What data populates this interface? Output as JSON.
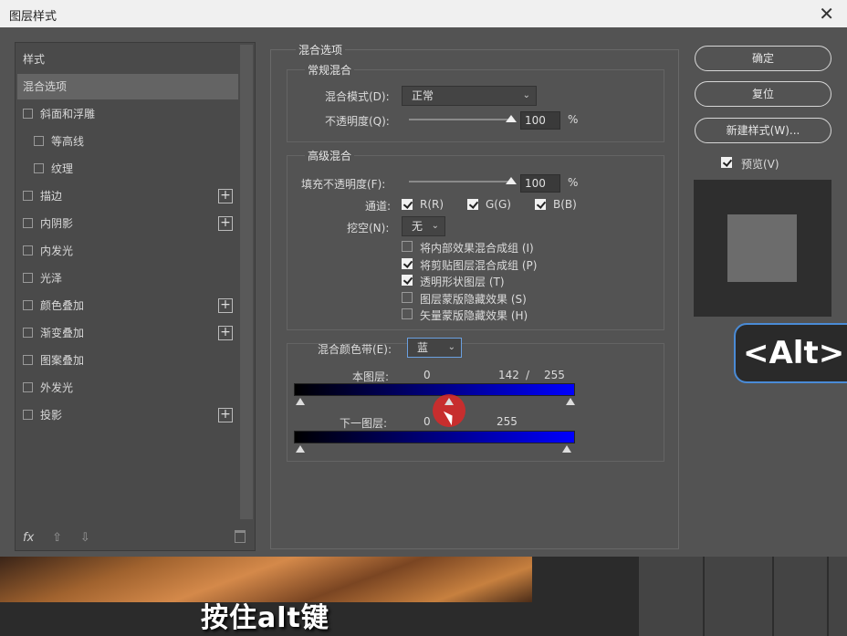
{
  "window": {
    "title": "图层样式",
    "close_icon": "close-icon"
  },
  "left_panel": {
    "header": "样式",
    "items": [
      {
        "label": "混合选项",
        "checkbox": false,
        "plus": false,
        "selected": true,
        "indent": 0
      },
      {
        "label": "斜面和浮雕",
        "checkbox": true,
        "plus": false,
        "indent": 0
      },
      {
        "label": "等高线",
        "checkbox": true,
        "plus": false,
        "indent": 1
      },
      {
        "label": "纹理",
        "checkbox": true,
        "plus": false,
        "indent": 1
      },
      {
        "label": "描边",
        "checkbox": true,
        "plus": true,
        "indent": 0
      },
      {
        "label": "内阴影",
        "checkbox": true,
        "plus": true,
        "indent": 0
      },
      {
        "label": "内发光",
        "checkbox": true,
        "plus": false,
        "indent": 0
      },
      {
        "label": "光泽",
        "checkbox": true,
        "plus": false,
        "indent": 0
      },
      {
        "label": "颜色叠加",
        "checkbox": true,
        "plus": true,
        "indent": 0
      },
      {
        "label": "渐变叠加",
        "checkbox": true,
        "plus": true,
        "indent": 0
      },
      {
        "label": "图案叠加",
        "checkbox": true,
        "plus": false,
        "indent": 0
      },
      {
        "label": "外发光",
        "checkbox": true,
        "plus": false,
        "indent": 0
      },
      {
        "label": "投影",
        "checkbox": true,
        "plus": true,
        "indent": 0
      }
    ],
    "footer": {
      "fx": "fx",
      "up": "⇧",
      "down": "⇩"
    }
  },
  "blend_options": {
    "title": "混合选项",
    "general": {
      "title": "常规混合",
      "mode_label": "混合模式(D):",
      "mode_value": "正常",
      "opacity_label": "不透明度(Q):",
      "opacity_value": "100",
      "percent": "%"
    },
    "advanced": {
      "title": "高级混合",
      "fill_label": "填充不透明度(F):",
      "fill_value": "100",
      "percent": "%",
      "channels_label": "通道:",
      "channel_r": "R(R)",
      "channel_g": "G(G)",
      "channel_b": "B(B)",
      "knockout_label": "挖空(N):",
      "knockout_value": "无",
      "options": [
        {
          "label": "将内部效果混合成组 (I)",
          "checked": false
        },
        {
          "label": "将剪贴图层混合成组 (P)",
          "checked": true
        },
        {
          "label": "透明形状图层 (T)",
          "checked": true
        },
        {
          "label": "图层蒙版隐藏效果 (S)",
          "checked": false
        },
        {
          "label": "矢量蒙版隐藏效果 (H)",
          "checked": false
        }
      ]
    },
    "blend_if": {
      "label": "混合颜色带(E):",
      "value": "蓝",
      "this_layer_label": "本图层:",
      "this_layer_left": "0",
      "this_layer_mid": "142",
      "this_layer_sep": "/",
      "this_layer_right": "255",
      "under_layer_label": "下一图层:",
      "under_layer_left": "0",
      "under_layer_right": "255"
    }
  },
  "buttons": {
    "ok": "确定",
    "reset": "复位",
    "new_style": "新建样式(W)...",
    "preview": "预览(V)"
  },
  "overlay": {
    "alt_badge": "<Alt>",
    "subtitle": "按住alt键"
  }
}
